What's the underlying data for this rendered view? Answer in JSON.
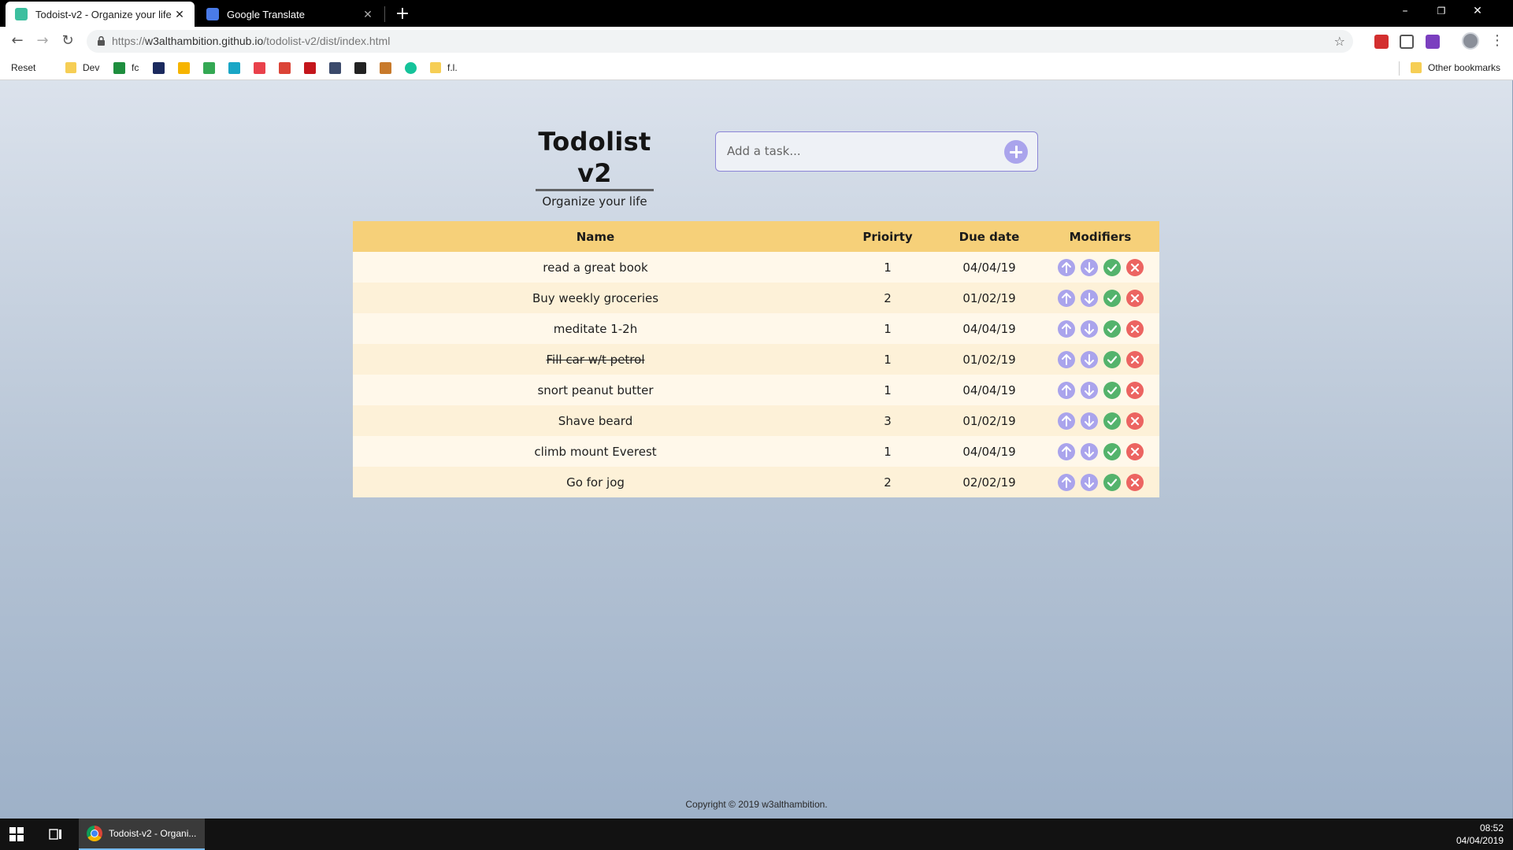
{
  "browser": {
    "tabs": [
      {
        "title": "Todoist-v2 - Organize your life",
        "favicon_color": "#3cbf9f"
      },
      {
        "title": "Google Translate",
        "favicon_color": "#4a7be8"
      }
    ],
    "new_tab_label": "+",
    "window_controls": {
      "minimize": "–",
      "restore": "❐",
      "close": "✕"
    },
    "url": {
      "scheme": "https://",
      "host": "w3althambition.github.io",
      "path": "/todolist-v2/dist/index.html"
    },
    "bookmarks": [
      {
        "label": "Reset",
        "type": "page"
      },
      {
        "label": "Dev",
        "type": "folder"
      },
      {
        "label": "fc",
        "type": "site",
        "color": "#1e8e3e"
      },
      {
        "label": "",
        "type": "site",
        "color": "#1b2a5e"
      },
      {
        "label": "",
        "type": "site",
        "color": "#f6b400"
      },
      {
        "label": "",
        "type": "site",
        "color": "#34a853"
      },
      {
        "label": "",
        "type": "site",
        "color": "#19a6c6"
      },
      {
        "label": "",
        "type": "site",
        "color": "#e9414b"
      },
      {
        "label": "",
        "type": "site",
        "color": "#db4437"
      },
      {
        "label": "",
        "type": "site",
        "color": "#c4161c"
      },
      {
        "label": "",
        "type": "site",
        "color": "#3b4a6b"
      },
      {
        "label": "",
        "type": "site",
        "color": "#222222"
      },
      {
        "label": "",
        "type": "site",
        "color": "#c87a2b"
      },
      {
        "label": "",
        "type": "site",
        "color": "#15c39a"
      },
      {
        "label": "f.l.",
        "type": "folder"
      }
    ],
    "other_bookmarks": "Other bookmarks",
    "extensions": [
      "#d32f2f",
      "#e94b5a",
      "#7b3fbf"
    ]
  },
  "app": {
    "title": "Todolist v2",
    "subtitle": "Organize your life",
    "input_placeholder": "Add a task...",
    "columns": {
      "name": "Name",
      "priority": "Prioirty",
      "due": "Due date",
      "modifiers": "Modifiers"
    },
    "tasks": [
      {
        "name": "read a great book",
        "priority": "1",
        "due": "04/04/19",
        "done": false
      },
      {
        "name": "Buy weekly groceries",
        "priority": "2",
        "due": "01/02/19",
        "done": false
      },
      {
        "name": "meditate 1-2h",
        "priority": "1",
        "due": "04/04/19",
        "done": false
      },
      {
        "name": "Fill car w/t petrol",
        "priority": "1",
        "due": "01/02/19",
        "done": true
      },
      {
        "name": "snort peanut butter",
        "priority": "1",
        "due": "04/04/19",
        "done": false
      },
      {
        "name": "Shave beard",
        "priority": "3",
        "due": "01/02/19",
        "done": false
      },
      {
        "name": "climb mount Everest",
        "priority": "1",
        "due": "04/04/19",
        "done": false
      },
      {
        "name": "Go for jog",
        "priority": "2",
        "due": "02/02/19",
        "done": false
      }
    ],
    "footer": "Copyright © 2019 w3althambition."
  },
  "taskbar": {
    "app_label": "Todoist-v2 - Organi...",
    "time": "08:52",
    "date": "04/04/2019"
  },
  "colors": {
    "header_bg": "#f6d079",
    "accent_purple": "#aaa4ec",
    "check_green": "#54b36c",
    "delete_red": "#ec6461"
  }
}
